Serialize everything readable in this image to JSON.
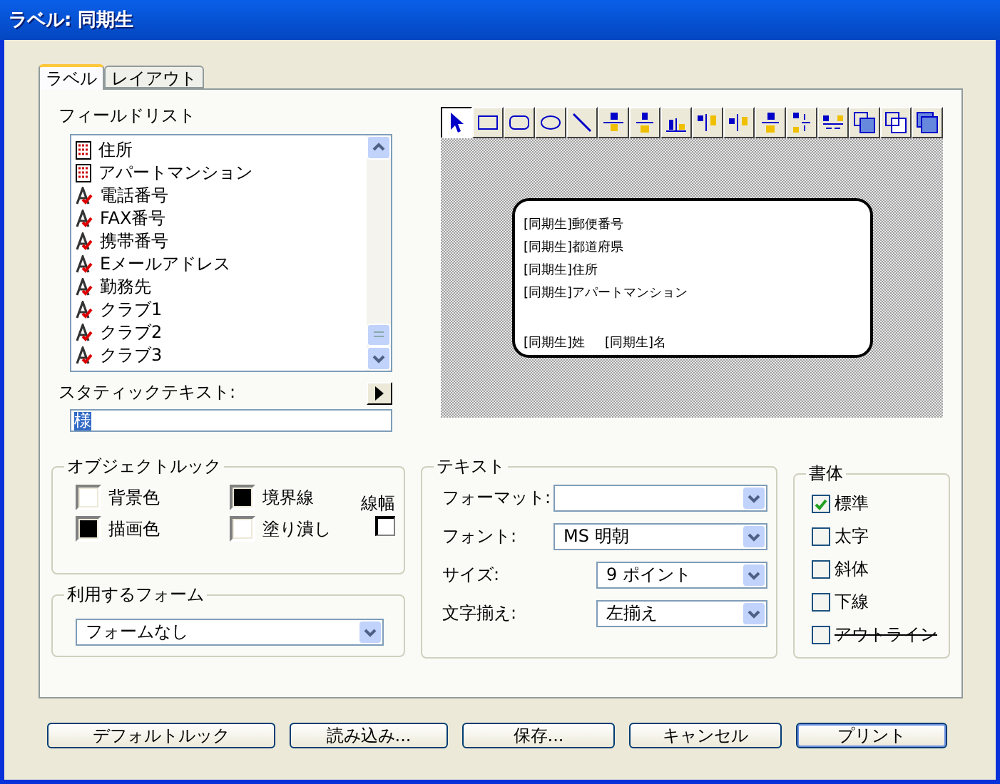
{
  "window": {
    "title": "ラベル: 同期生"
  },
  "tabs": [
    {
      "label": "ラベル",
      "selected": true
    },
    {
      "label": "レイアウト",
      "selected": false
    }
  ],
  "field_list": {
    "label": "フィールドリスト",
    "items": [
      {
        "text": "住所",
        "kind": "field"
      },
      {
        "text": "アパートマンション",
        "kind": "field"
      },
      {
        "text": "電話番号",
        "kind": "text"
      },
      {
        "text": "FAX番号",
        "kind": "text"
      },
      {
        "text": "携帯番号",
        "kind": "text"
      },
      {
        "text": "Eメールアドレス",
        "kind": "text"
      },
      {
        "text": "勤務先",
        "kind": "text"
      },
      {
        "text": "クラブ1",
        "kind": "text"
      },
      {
        "text": "クラブ2",
        "kind": "text"
      },
      {
        "text": "クラブ3",
        "kind": "text"
      }
    ]
  },
  "static_text": {
    "label": "スタティックテキスト:",
    "value": "様",
    "highlighted": true
  },
  "tools": [
    {
      "kind": "pointer",
      "selected": true
    },
    {
      "kind": "rect",
      "selected": false
    },
    {
      "kind": "roundrect",
      "selected": false
    },
    {
      "kind": "oval",
      "selected": false
    },
    {
      "kind": "line",
      "selected": false
    },
    {
      "kind": "align-left",
      "selected": false
    },
    {
      "kind": "align-hcenter",
      "selected": false
    },
    {
      "kind": "align-bottom",
      "selected": false
    },
    {
      "kind": "align-top",
      "selected": false
    },
    {
      "kind": "align-vcenter",
      "selected": false
    },
    {
      "kind": "align-right",
      "selected": false
    },
    {
      "kind": "distribute-v",
      "selected": false
    },
    {
      "kind": "distribute-h",
      "selected": false
    },
    {
      "kind": "front",
      "selected": false
    },
    {
      "kind": "back",
      "selected": false
    },
    {
      "kind": "group",
      "selected": false
    }
  ],
  "preview": {
    "rows": [
      {
        "kind": "fields",
        "fields": [
          "[同期生]郵便番号"
        ]
      },
      {
        "kind": "fields",
        "fields": [
          "[同期生]都道府県"
        ]
      },
      {
        "kind": "fields",
        "fields": [
          "[同期生]住所"
        ]
      },
      {
        "kind": "fields",
        "fields": [
          "[同期生]アパートマンション"
        ]
      },
      {
        "kind": "blank"
      },
      {
        "kind": "fields",
        "fields": [
          "[同期生]姓",
          "[同期生]名"
        ]
      }
    ]
  },
  "object_look": {
    "title": "オブジェクトルック",
    "swatches": [
      {
        "label": "背景色",
        "color": "#ffffff"
      },
      {
        "label": "境界線",
        "color": "#000000"
      },
      {
        "label": "描画色",
        "color": "#000000"
      },
      {
        "label": "塗り潰し",
        "color": "#ffffff"
      }
    ],
    "line_width_label": "線幅"
  },
  "form": {
    "title": "利用するフォーム",
    "value": "フォームなし"
  },
  "text": {
    "title": "テキスト",
    "rows": [
      {
        "label": "フォーマット:",
        "kind": "wide"
      },
      {
        "label": "フォント:",
        "value": "MS 明朝",
        "kind": "wide"
      },
      {
        "label": "サイズ:",
        "value": "9 ポイント",
        "kind": "short"
      },
      {
        "label": "文字揃え:",
        "value": "左揃え",
        "kind": "short"
      }
    ]
  },
  "style": {
    "title": "書体",
    "options": [
      {
        "label": "標準",
        "checked": true,
        "kind": "plain"
      },
      {
        "label": "太字",
        "checked": false,
        "kind": "plain"
      },
      {
        "label": "斜体",
        "checked": false,
        "kind": "plain"
      },
      {
        "label": "下線",
        "checked": false,
        "kind": "plain"
      },
      {
        "label": "アウトライン",
        "checked": false,
        "kind": "outline"
      }
    ]
  },
  "buttons": [
    {
      "label": "デフォルトルック",
      "default": false
    },
    {
      "label": "読み込み...",
      "default": false
    },
    {
      "label": "保存...",
      "default": false
    },
    {
      "label": "キャンセル",
      "default": false
    },
    {
      "label": "プリント",
      "default": true
    }
  ]
}
